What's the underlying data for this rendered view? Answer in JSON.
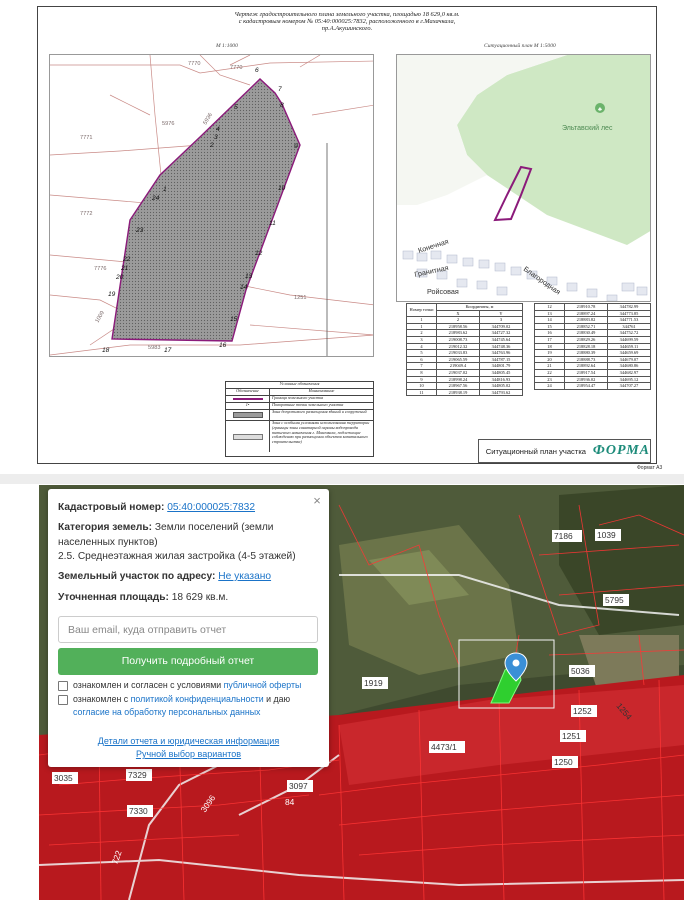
{
  "drawing": {
    "title_line1": "Чертеж градостроительного плана земельного участка,   площадью 18 629,0 кв.м.",
    "title_line2": "с кадастровым номером    № 05:40:000025:7832, расположенного в г.Махачкала,",
    "title_line3": "пр.А.Акушинского.",
    "plan_scale": "М 1:1000",
    "situation_title": "Ситуационный план М 1:5000",
    "stamp_title": "Ситуационный план участка",
    "stamp_logo": "ФОРМА",
    "format_label": "Формат А3",
    "forest_label": "Эльтавский лес",
    "street_labels": [
      "Конечная",
      "Гранитная",
      "Ройсовая",
      "Благородная"
    ],
    "parcel_labels": [
      "7770",
      "7770",
      "5976",
      "7771",
      "7772",
      "7776",
      "5983",
      "1251",
      "5936",
      "1009"
    ],
    "point_numbers": [
      "1",
      "2",
      "3",
      "4",
      "5",
      "6",
      "7",
      "8",
      "9",
      "10",
      "11",
      "12",
      "13",
      "14",
      "15",
      "16",
      "17",
      "18",
      "19",
      "20",
      "21",
      "22",
      "23",
      "24"
    ],
    "table1": {
      "headers": [
        "Номер точки",
        "Координаты, м",
        "X",
        "Y"
      ],
      "col_index": [
        "1",
        "2",
        "3"
      ],
      "rows": [
        [
          "1",
          "218958.56",
          "344709.02"
        ],
        [
          "2",
          "218983.62",
          "344727.32"
        ],
        [
          "3",
          "219008.73",
          "344745.64"
        ],
        [
          "4",
          "219012.32",
          "344748.36"
        ],
        [
          "5",
          "219033.83",
          "344763.96"
        ],
        [
          "6",
          "219065.59",
          "344787.15"
        ],
        [
          "7",
          "219049.4",
          "344801.79"
        ],
        [
          "8",
          "219037.02",
          "344805.45"
        ],
        [
          "9",
          "218998.24",
          "344816.93"
        ],
        [
          "10",
          "218967.56",
          "344805.02"
        ],
        [
          "11",
          "218938.19",
          "344793.62"
        ]
      ]
    },
    "table2": {
      "rows": [
        [
          "12",
          "218910.78",
          "344782.99"
        ],
        [
          "13",
          "218897.24",
          "344773.85"
        ],
        [
          "14",
          "218883.82",
          "344771.53"
        ],
        [
          "15",
          "218852.71",
          "344761"
        ],
        [
          "16",
          "218830.49",
          "344752.72"
        ],
        [
          "17",
          "218829.26",
          "344699.59"
        ],
        [
          "18",
          "218828.18",
          "344659.11"
        ],
        [
          "19",
          "218880.39",
          "344659.69"
        ],
        [
          "20",
          "218888.73",
          "344679.07"
        ],
        [
          "21",
          "218892.64",
          "344680.86"
        ],
        [
          "22",
          "218917.54",
          "344682.97"
        ],
        [
          "23",
          "218936.02",
          "344695.12"
        ],
        [
          "24",
          "218954.47",
          "344707.27"
        ]
      ]
    },
    "legend": {
      "title": "Условные обозначения",
      "col1": "Обозначение",
      "col2": "Наименование",
      "items": [
        "Граница земельного участка",
        "Поворотные точки земельного участка",
        "Зона допустимого размещения зданий и сооружений",
        "Зона с особыми условиями использования территории (границы зоны санитарной охраны водопровода питьевого назначения г. Махачкала, подлежащие соблюдению при размещении объектов капитального строительства)"
      ],
      "sym_point": "1•"
    }
  },
  "map": {
    "labels": [
      "7186",
      "1039",
      "5795",
      "5036",
      "1252",
      "1254",
      "1251",
      "1250",
      "1919",
      "4473/1",
      "3035",
      "7329",
      "7330",
      "3096",
      "3097",
      "84",
      "722"
    ]
  },
  "card": {
    "cadastral_label": "Кадастровый номер:",
    "cadastral_value": "05:40:000025:7832",
    "category_label": "Категория земель:",
    "category_value": "Земли поселений (земли",
    "category_value2": "населенных пунктов)",
    "usage": "2.5. Среднеэтажная жилая застройка (4-5 этажей)",
    "address_label": "Земельный участок по адресу:",
    "address_value": "Не указано",
    "area_label": "Уточненная площадь:",
    "area_value": "18 629 кв.м.",
    "email_placeholder": "Ваш email, куда отправить отчет",
    "submit_label": "Получить подробный отчет",
    "consent1_prefix": "ознакомлен и согласен с условиями",
    "consent1_link": "публичной оферты",
    "consent2_prefix": "ознакомлен с",
    "consent2_link": "политикой конфиденциальности",
    "consent2_suffix": "и даю",
    "consent2_link2": "согласие на обработку персональных данных",
    "details_link": "Детали отчета и юридическая информация",
    "manual_link": "Ручной выбор вариантов",
    "close_icon": "×"
  },
  "colors": {
    "accent_green": "#52b05a",
    "link_blue": "#1a73c8",
    "parcel_red": "#e8202a",
    "parcel_purple": "#8b1a7a",
    "marker_blue": "#3a8fd6",
    "brand_teal": "#1d8b7a"
  }
}
